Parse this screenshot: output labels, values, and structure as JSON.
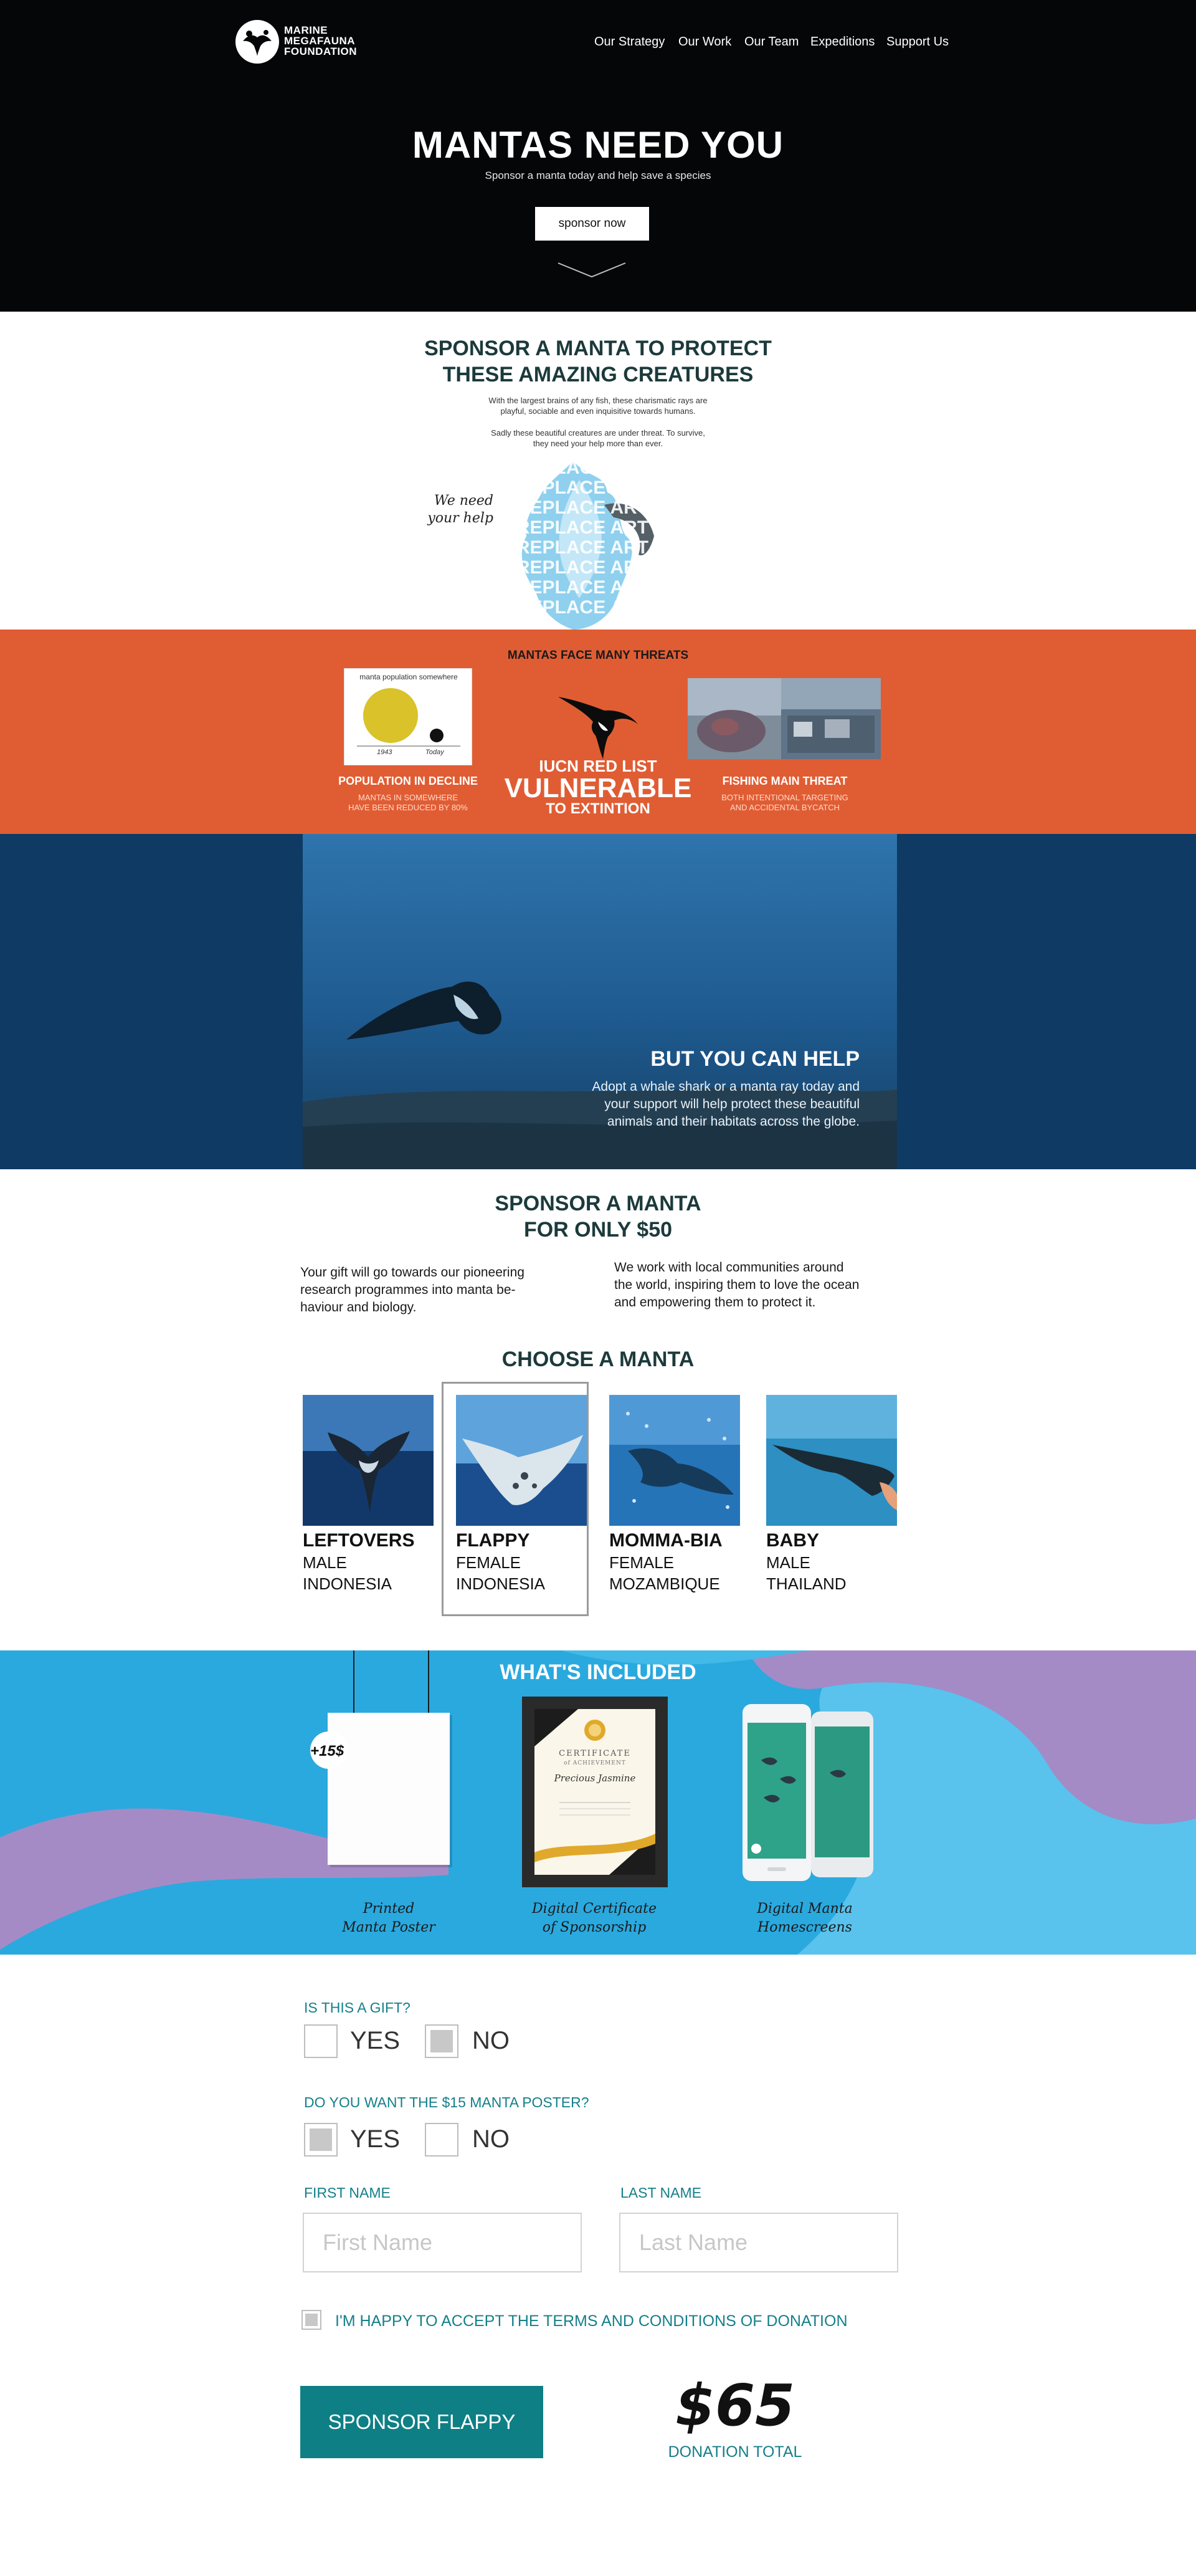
{
  "colors": {
    "hero_bg": "#050607",
    "threats_bg": "#e05d34",
    "help_bg": "#0f3a63",
    "included_bg": "#2aa9df",
    "included_wave": "#a58bc6",
    "accent_teal": "#15808b",
    "button_teal": "#0e7f85",
    "pie_yellow": "#d9c22a"
  },
  "header": {
    "logo": {
      "line1": "MARINE",
      "line2": "MEGAFAUNA",
      "line3": "FOUNDATION",
      "icon": "manta-logo-icon"
    },
    "nav": [
      "Our Strategy",
      "Our Work",
      "Our Team",
      "Expeditions",
      "Support Us"
    ]
  },
  "hero": {
    "title": "MANTAS NEED YOU",
    "subtitle": "Sponsor a manta today and help save a species",
    "button": "sponsor now",
    "scroll_icon": "chevron-down-icon"
  },
  "protect": {
    "title_line1": "SPONSOR A MANTA TO PROTECT",
    "title_line2": "THESE AMAZING CREATURES",
    "p1_line1": "With the largest brains of any fish, these charismatic rays are",
    "p1_line2": "playful, sociable and even inquisitive towards humans.",
    "p2_line1": "Sadly these beautiful creatures are under threat. To survive,",
    "p2_line2": "they need your help more than ever.",
    "note_line1": "We need",
    "note_line2": "your help",
    "placeholder_art": "REPLACE ART"
  },
  "threats": {
    "title": "MANTAS FACE MANY THREATS",
    "chart": {
      "title": "manta population somewhere",
      "labels": [
        "1943",
        "Today"
      ]
    },
    "population": {
      "title": "POPULATION IN DECLINE",
      "line1": "MANTAS IN SOMEWHERE",
      "line2": "HAVE BEEN REDUCED BY 80%"
    },
    "iucn": {
      "line1": "IUCN RED LIST",
      "line2": "VULNERABLE",
      "line3": "TO EXTINTION"
    },
    "fishing": {
      "title": "FISHING MAIN THREAT",
      "line1": "BOTH INTENTIONAL TARGETING",
      "line2": "AND ACCIDENTAL BYCATCH"
    }
  },
  "help": {
    "title": "BUT YOU CAN HELP",
    "line1": "Adopt a whale shark or a manta ray today and",
    "line2": "your support will help protect these beautiful",
    "line3": "animals and their habitats across the globe."
  },
  "sponsor": {
    "title_line1": "SPONSOR A MANTA",
    "title_line2": "FOR ONLY $50",
    "left_line1": "Your gift will go towards our pioneering",
    "left_line2": "research programmes into manta be-",
    "left_line3": "haviour and biology.",
    "right_line1": "We work with local communities around",
    "right_line2": "the world, inspiring them to love the ocean",
    "right_line3": "and empowering them to protect it."
  },
  "choose": {
    "title": "CHOOSE A MANTA",
    "mantas": [
      {
        "name": "LEFTOVERS",
        "sex": "MALE",
        "location": "INDONESIA",
        "selected": false
      },
      {
        "name": "FLAPPY",
        "sex": "FEMALE",
        "location": "INDONESIA",
        "selected": true
      },
      {
        "name": "MOMMA-BIA",
        "sex": "FEMALE",
        "location": "MOZAMBIQUE",
        "selected": false
      },
      {
        "name": "BABY",
        "sex": "MALE",
        "location": "THAILAND",
        "selected": false
      }
    ]
  },
  "included": {
    "title": "WHAT'S INCLUDED",
    "poster_price": "+15$",
    "certificate_title": "CERTIFICATE",
    "certificate_subtitle": "of ACHIEVEMENT",
    "certificate_name": "Precious Jasmine",
    "items": [
      {
        "line1": "Printed",
        "line2": "Manta Poster"
      },
      {
        "line1": "Digital Certificate",
        "line2": "of Sponsorship"
      },
      {
        "line1": "Digital Manta",
        "line2": "Homescreens"
      }
    ]
  },
  "form": {
    "gift_question": "IS THIS A GIFT?",
    "gift_yes": "YES",
    "gift_no": "NO",
    "gift_value": "NO",
    "poster_question": "DO YOU WANT THE $15 MANTA POSTER?",
    "poster_yes": "YES",
    "poster_no": "NO",
    "poster_value": "YES",
    "first_name_label": "FIRST NAME",
    "first_name_placeholder": "First Name",
    "last_name_label": "LAST NAME",
    "last_name_placeholder": "Last Name",
    "terms": "I'M HAPPY TO ACCEPT THE TERMS AND CONDITIONS OF DONATION",
    "submit": "SPONSOR FLAPPY",
    "total": "$65",
    "total_label": "DONATION TOTAL"
  }
}
